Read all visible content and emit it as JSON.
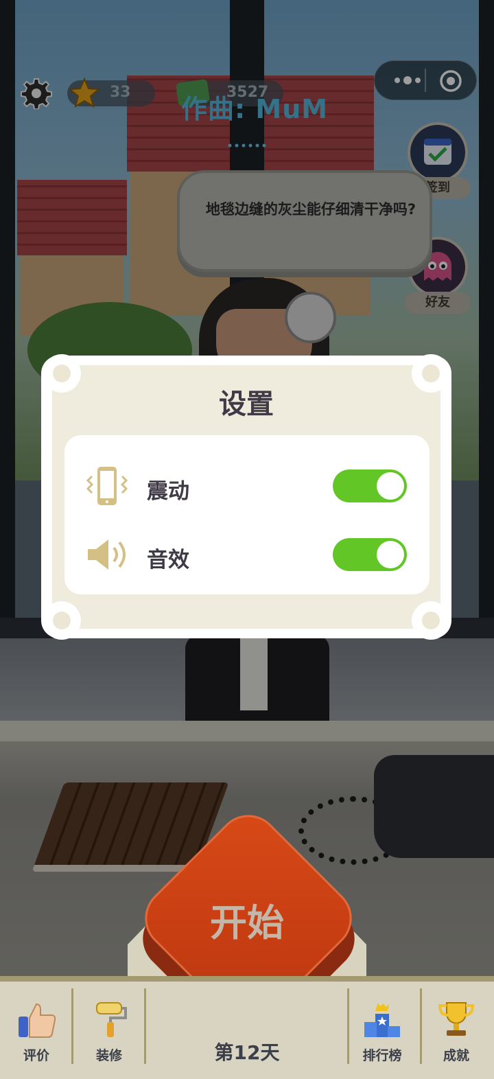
{
  "hud": {
    "stars": "33",
    "cash": "3527",
    "credit": "作曲: MuM"
  },
  "capsule": {
    "more_icon": "more-dots-icon",
    "close_icon": "target-close-icon"
  },
  "side_buttons": {
    "checkin": "签到",
    "friends": "好友"
  },
  "dialogue": {
    "text": "地毯边缝的灰尘能仔细清干净吗?"
  },
  "settings": {
    "title": "设置",
    "rows": [
      {
        "label": "震动",
        "icon": "vibration-phone-icon",
        "enabled": true
      },
      {
        "label": "音效",
        "icon": "speaker-icon",
        "enabled": true
      }
    ]
  },
  "start": {
    "label": "开始"
  },
  "bottom_bar": {
    "items": [
      {
        "label": "评价",
        "icon": "thumbs-up-icon"
      },
      {
        "label": "装修",
        "icon": "paint-roller-icon"
      },
      {
        "label": "排行榜",
        "icon": "podium-icon"
      },
      {
        "label": "成就",
        "icon": "trophy-icon"
      }
    ],
    "day": "第12天"
  },
  "colors": {
    "toggle_on": "#62c726",
    "start_button": "#c8401a",
    "credit_text": "#55b8de",
    "dialog_bg": "#efebdd",
    "icon_gold": "#d4c084"
  }
}
